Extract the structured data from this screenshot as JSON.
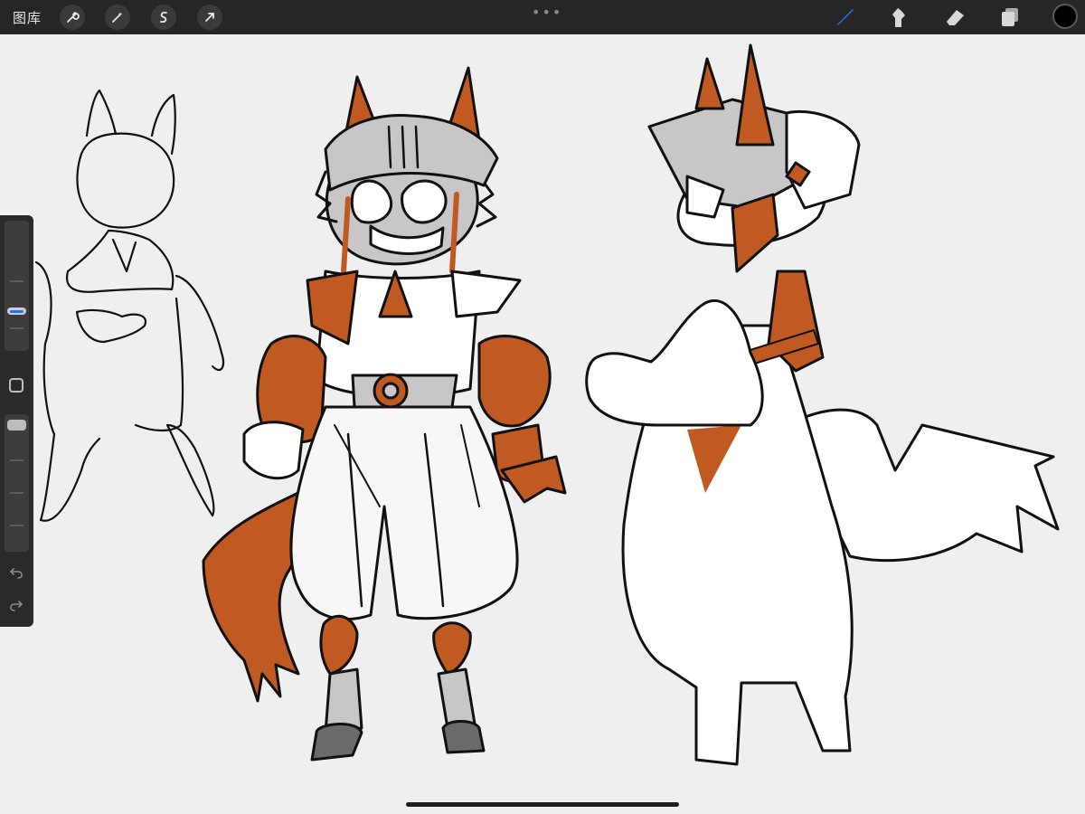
{
  "toolbar": {
    "gallery_label": "图库",
    "left_tools": [
      "wrench-icon",
      "magic-wand-icon",
      "selection-icon",
      "transform-arrow-icon"
    ],
    "right_tools": [
      "brush-icon",
      "smudge-icon",
      "eraser-icon",
      "layers-icon"
    ],
    "active_tool": "brush-icon",
    "accent_color": "#2a6ef5",
    "current_color": "#000000",
    "more_icon": "ellipsis-icon"
  },
  "sidebar": {
    "brush_size_level": 0.4,
    "opacity_level": 1.0,
    "modify_icon": "square-icon",
    "undo_icon": "undo-icon",
    "redo_icon": "redo-icon"
  },
  "canvas": {
    "background": "#efefef",
    "accent_orange": "#c05a22",
    "armor_gray": "#c8c6c6",
    "figures": [
      "front-sketch",
      "armored-front-view",
      "side-back-view"
    ]
  }
}
